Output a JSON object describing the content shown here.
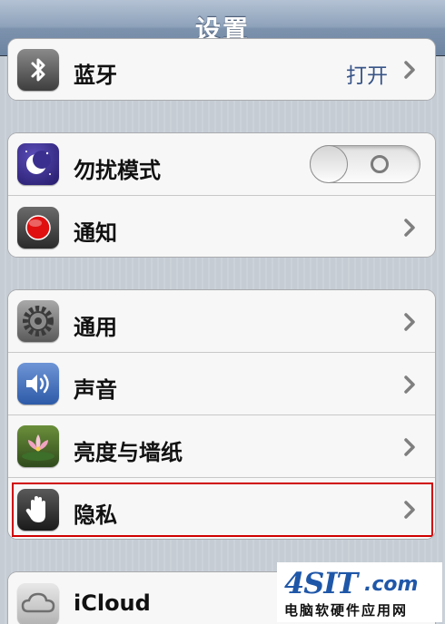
{
  "navbar": {
    "title": "设置"
  },
  "group1": {
    "items": [
      {
        "label": "蓝牙",
        "value": "打开",
        "icon": "bluetooth-icon"
      }
    ]
  },
  "group2": {
    "items": [
      {
        "label": "勿扰模式",
        "icon": "moon-icon",
        "toggle": "off"
      },
      {
        "label": "通知",
        "icon": "notifications-icon"
      }
    ]
  },
  "group3": {
    "items": [
      {
        "label": "通用",
        "icon": "gear-icon"
      },
      {
        "label": "声音",
        "icon": "speaker-icon"
      },
      {
        "label": "亮度与墙纸",
        "icon": "wallpaper-flower-icon"
      },
      {
        "label": "隐私",
        "icon": "privacy-hand-icon",
        "highlighted": true
      }
    ]
  },
  "group4": {
    "items": [
      {
        "label": "iCloud",
        "icon": "cloud-icon"
      }
    ]
  },
  "watermark": {
    "logo": "4SIT",
    "domain": ".com",
    "subtitle": "电脑软硬件应用网"
  },
  "colors": {
    "navbar": "#7c92ad",
    "value_text": "#385487",
    "highlight_border": "#d00000",
    "watermark_blue": "#1f57a8"
  }
}
